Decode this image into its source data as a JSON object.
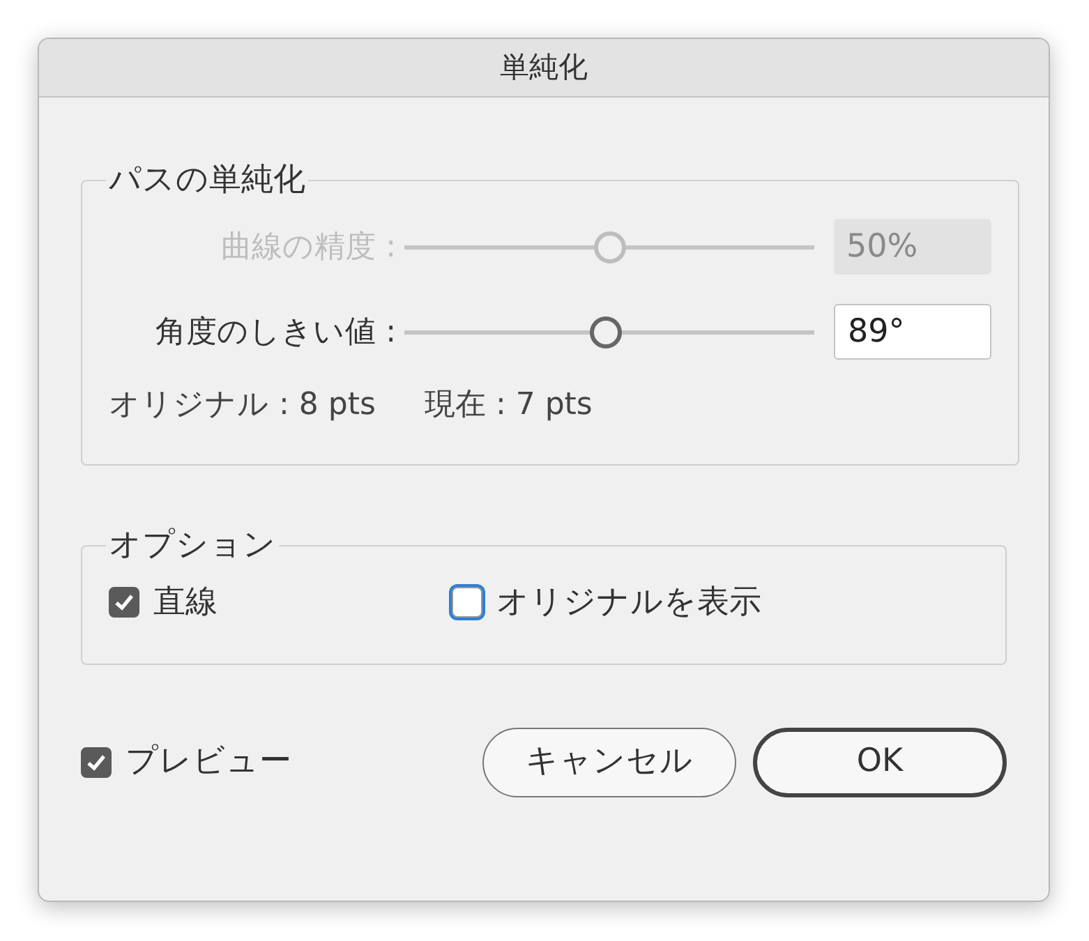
{
  "window": {
    "title": "単純化"
  },
  "simplify_group": {
    "title": "パスの単純化",
    "sliders": [
      {
        "label": "曲線の精度 :",
        "level": 0.5,
        "value": "50%",
        "disabled": true
      },
      {
        "label": "角度のしきい値 :",
        "level": 0.49,
        "value": "89°",
        "disabled": false
      }
    ],
    "original": "オリジナル : 8 pts",
    "current": "現在 : 7 pts"
  },
  "options_group": {
    "title": "オプション",
    "checkboxes": [
      {
        "label": "直線",
        "checked": true,
        "focused": false
      },
      {
        "label": "オリジナルを表示",
        "checked": false,
        "focused": true
      }
    ]
  },
  "preview": {
    "label": "プレビュー",
    "checked": true
  },
  "buttons": [
    {
      "label": "キャンセル",
      "default": false
    },
    {
      "label": "OK",
      "default": true
    }
  ]
}
